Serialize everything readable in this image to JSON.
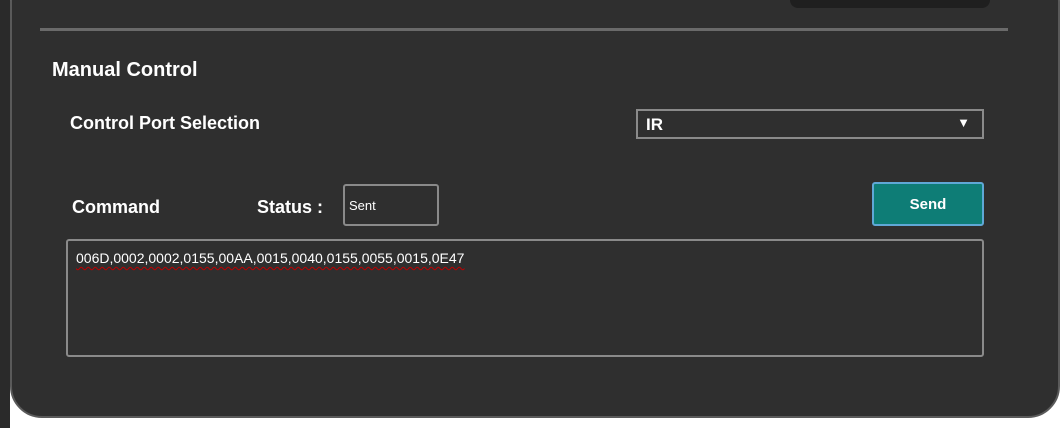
{
  "manual_control": {
    "title": "Manual Control",
    "port_selection_label": "Control Port Selection",
    "port_selected": "IR",
    "port_dropdown_arrow": "▼",
    "command_label": "Command",
    "status_label": "Status :",
    "status_value": "Sent",
    "send_label": "Send",
    "command_text": "006D,0002,0002,0155,00AA,0015,0040,0155,0055,0015,0E47"
  },
  "colors": {
    "panel_bg": "#2f2f2f",
    "send_button": "#0e7d76",
    "spellcheck_underline": "#c00000"
  }
}
